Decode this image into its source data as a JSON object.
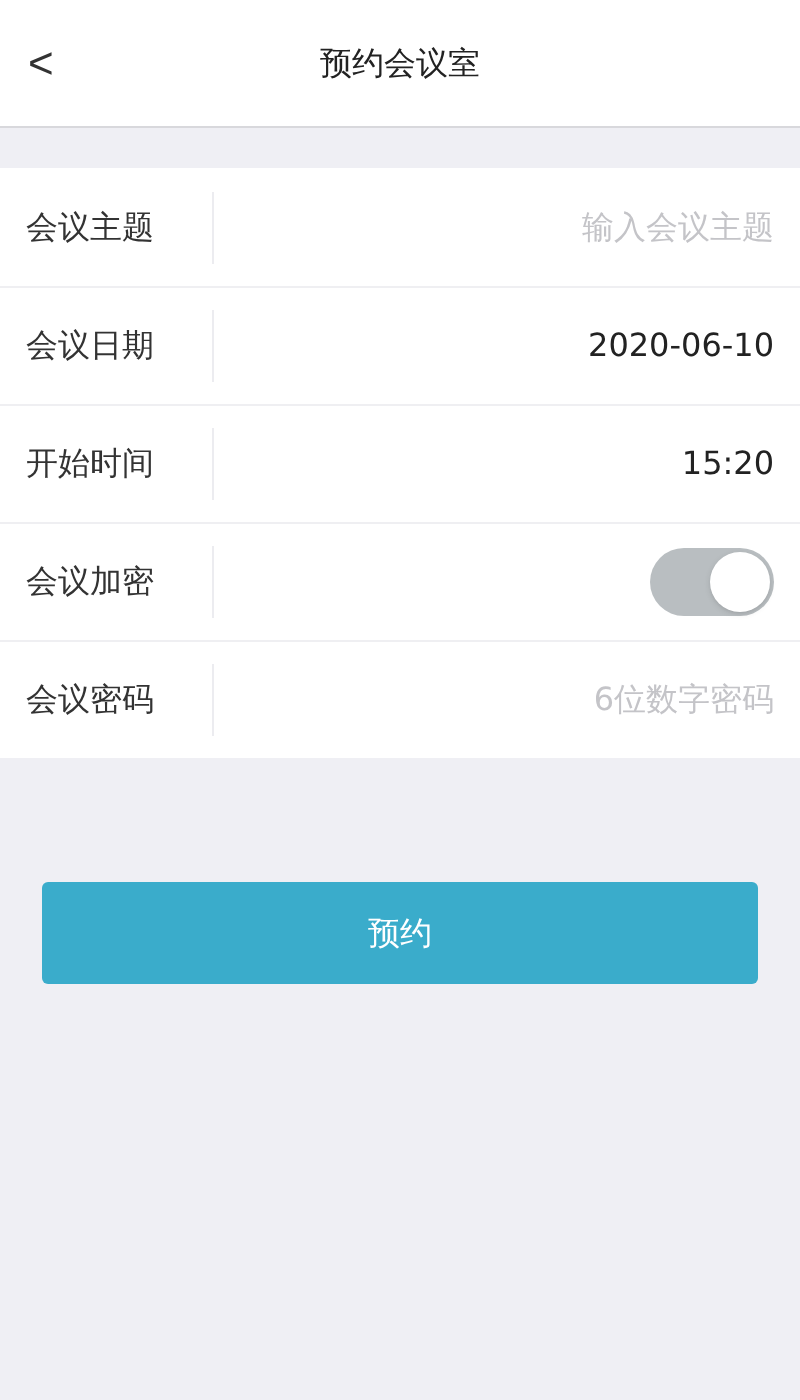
{
  "header": {
    "back": "<",
    "title": "预约会议室"
  },
  "rows": [
    {
      "kind": "input",
      "label": "会议主题",
      "placeholder": "输入会议主题"
    },
    {
      "kind": "value",
      "label": "会议日期",
      "value": "2020-06-10"
    },
    {
      "kind": "value",
      "label": "开始时间",
      "value": "15:20"
    },
    {
      "kind": "toggle",
      "label": "会议加密",
      "on": true
    },
    {
      "kind": "input",
      "label": "会议密码",
      "placeholder": "6位数字密码"
    }
  ],
  "button": "预约"
}
